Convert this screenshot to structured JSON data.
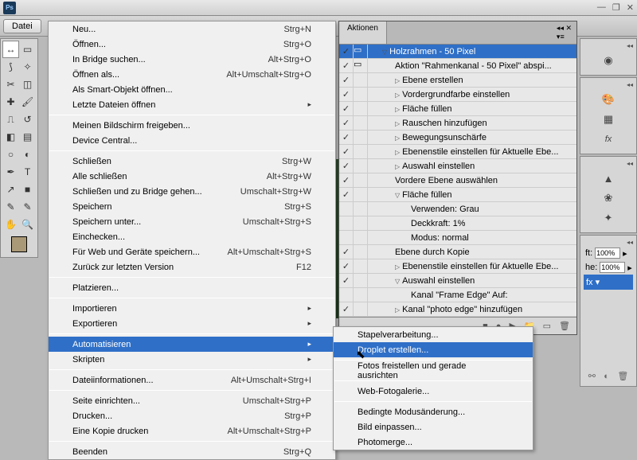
{
  "app": {
    "logo": "Ps"
  },
  "filebar": {
    "button": "Datei"
  },
  "window_buttons": {
    "min": "—",
    "max": "❐",
    "close": "✕"
  },
  "menu": {
    "items": [
      {
        "label": "Neu...",
        "shortcut": "Strg+N"
      },
      {
        "label": "Öffnen...",
        "shortcut": "Strg+O"
      },
      {
        "label": "In Bridge suchen...",
        "shortcut": "Alt+Strg+O"
      },
      {
        "label": "Öffnen als...",
        "shortcut": "Alt+Umschalt+Strg+O"
      },
      {
        "label": "Als Smart-Objekt öffnen...",
        "shortcut": ""
      },
      {
        "label": "Letzte Dateien öffnen",
        "shortcut": "",
        "sub": true
      },
      {
        "sep": true
      },
      {
        "label": "Meinen Bildschirm freigeben...",
        "shortcut": ""
      },
      {
        "label": "Device Central...",
        "shortcut": ""
      },
      {
        "sep": true
      },
      {
        "label": "Schließen",
        "shortcut": "Strg+W"
      },
      {
        "label": "Alle schließen",
        "shortcut": "Alt+Strg+W"
      },
      {
        "label": "Schließen und zu Bridge gehen...",
        "shortcut": "Umschalt+Strg+W"
      },
      {
        "label": "Speichern",
        "shortcut": "Strg+S"
      },
      {
        "label": "Speichern unter...",
        "shortcut": "Umschalt+Strg+S"
      },
      {
        "label": "Einchecken...",
        "shortcut": ""
      },
      {
        "label": "Für Web und Geräte speichern...",
        "shortcut": "Alt+Umschalt+Strg+S"
      },
      {
        "label": "Zurück zur letzten Version",
        "shortcut": "F12"
      },
      {
        "sep": true
      },
      {
        "label": "Platzieren...",
        "shortcut": ""
      },
      {
        "sep": true
      },
      {
        "label": "Importieren",
        "shortcut": "",
        "sub": true
      },
      {
        "label": "Exportieren",
        "shortcut": "",
        "sub": true
      },
      {
        "sep": true
      },
      {
        "label": "Automatisieren",
        "shortcut": "",
        "sub": true,
        "hl": true
      },
      {
        "label": "Skripten",
        "shortcut": "",
        "sub": true
      },
      {
        "sep": true
      },
      {
        "label": "Dateiinformationen...",
        "shortcut": "Alt+Umschalt+Strg+I"
      },
      {
        "sep": true
      },
      {
        "label": "Seite einrichten...",
        "shortcut": "Umschalt+Strg+P"
      },
      {
        "label": "Drucken...",
        "shortcut": "Strg+P"
      },
      {
        "label": "Eine Kopie drucken",
        "shortcut": "Alt+Umschalt+Strg+P"
      },
      {
        "sep": true
      },
      {
        "label": "Beenden",
        "shortcut": "Strg+Q"
      }
    ]
  },
  "submenu": {
    "items": [
      {
        "label": "Stapelverarbeitung..."
      },
      {
        "label": "Droplet erstellen...",
        "hl": true
      },
      {
        "sep": true
      },
      {
        "label": "Fotos freistellen und gerade ausrichten"
      },
      {
        "sep": true
      },
      {
        "label": "Web-Fotogalerie..."
      },
      {
        "sep": true
      },
      {
        "label": "Bedingte Modusänderung..."
      },
      {
        "label": "Bild einpassen..."
      },
      {
        "label": "Photomerge..."
      }
    ]
  },
  "actions": {
    "tab": "Aktionen",
    "rows": [
      {
        "chk": true,
        "box": true,
        "indent": 14,
        "tri": "▽",
        "txt": "Holzrahmen - 50 Pixel",
        "sel": true
      },
      {
        "chk": true,
        "box": true,
        "indent": 30,
        "txt": "Aktion \"Rahmenkanal - 50 Pixel\" abspi..."
      },
      {
        "chk": true,
        "box": false,
        "indent": 30,
        "tri": "▷",
        "txt": "Ebene erstellen"
      },
      {
        "chk": true,
        "box": false,
        "indent": 30,
        "tri": "▷",
        "txt": "Vordergrundfarbe einstellen"
      },
      {
        "chk": true,
        "box": false,
        "indent": 30,
        "tri": "▷",
        "txt": "Fläche füllen"
      },
      {
        "chk": true,
        "box": false,
        "indent": 30,
        "tri": "▷",
        "txt": "Rauschen hinzufügen"
      },
      {
        "chk": true,
        "box": false,
        "indent": 30,
        "tri": "▷",
        "txt": "Bewegungsunschärfe"
      },
      {
        "chk": true,
        "box": false,
        "indent": 30,
        "tri": "▷",
        "txt": "Ebenenstile einstellen  für Aktuelle Ebe..."
      },
      {
        "chk": true,
        "box": false,
        "indent": 30,
        "tri": "▷",
        "txt": "Auswahl einstellen"
      },
      {
        "chk": true,
        "box": false,
        "indent": 30,
        "txt": "Vordere Ebene auswählen"
      },
      {
        "chk": true,
        "box": false,
        "indent": 30,
        "tri": "▽",
        "txt": "Fläche füllen"
      },
      {
        "chk": false,
        "box": false,
        "indent": 50,
        "txt": "Verwenden: Grau"
      },
      {
        "chk": false,
        "box": false,
        "indent": 50,
        "txt": "Deckkraft: 1%"
      },
      {
        "chk": false,
        "box": false,
        "indent": 50,
        "txt": "Modus: normal"
      },
      {
        "chk": true,
        "box": false,
        "indent": 30,
        "txt": "Ebene durch Kopie"
      },
      {
        "chk": true,
        "box": false,
        "indent": 30,
        "tri": "▷",
        "txt": "Ebenenstile einstellen  für Aktuelle Ebe..."
      },
      {
        "chk": true,
        "box": false,
        "indent": 30,
        "tri": "▽",
        "txt": "Auswahl einstellen"
      },
      {
        "chk": false,
        "box": false,
        "indent": 50,
        "txt": "Kanal \"Frame Edge\" Auf:"
      },
      {
        "chk": true,
        "box": false,
        "indent": 30,
        "tri": "▷",
        "txt": "Kanal \"photo edge\" hinzufügen"
      }
    ],
    "footer": {
      "stop": "■",
      "rec": "●",
      "play": "▶",
      "folder": "📁",
      "new": "▭",
      "trash": "🗑"
    }
  },
  "right": {
    "opacity_label": "ft:",
    "opacity_value": "100%",
    "fill_label": "he:",
    "fill_value": "100%",
    "fx": "fx"
  }
}
